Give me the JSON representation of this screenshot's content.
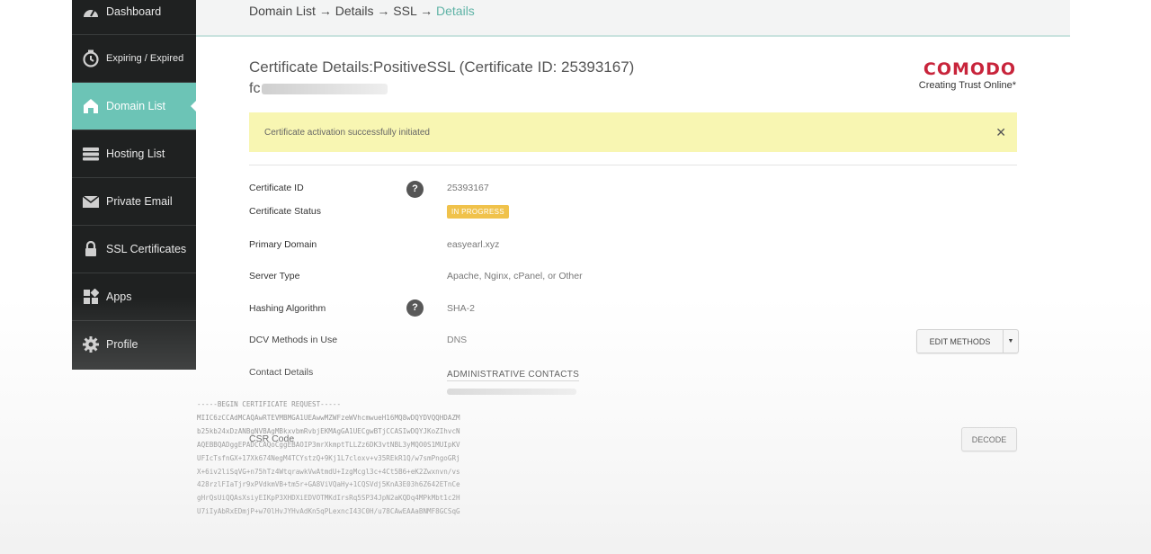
{
  "sidebar": {
    "items": [
      {
        "label": "Dashboard",
        "icon": "dashboard-icon"
      },
      {
        "label": "Expiring / Expired",
        "icon": "clock-icon"
      },
      {
        "label": "Domain List",
        "icon": "home-icon",
        "active": true
      },
      {
        "label": "Hosting List",
        "icon": "server-icon"
      },
      {
        "label": "Private Email",
        "icon": "envelope-icon"
      },
      {
        "label": "SSL Certificates",
        "icon": "lock-icon"
      },
      {
        "label": "Apps",
        "icon": "apps-icon"
      },
      {
        "label": "Profile",
        "icon": "gear-icon"
      }
    ]
  },
  "breadcrumb": {
    "items": [
      "Domain List",
      "Details",
      "SSL"
    ],
    "current": "Details",
    "separator": "→"
  },
  "page": {
    "title": "Certificate Details:PositiveSSL (Certificate ID: 25393167)",
    "subtitle_prefix": "fc"
  },
  "brand": {
    "name": "COMODO",
    "tagline": "Creating Trust Online*",
    "color": "#c8243b"
  },
  "alert": {
    "message": "Certificate activation successfully initiated",
    "close": "✕"
  },
  "details": {
    "certificate_id": {
      "label": "Certificate ID",
      "value": "25393167"
    },
    "status": {
      "label": "Certificate Status",
      "value": "IN PROGRESS"
    },
    "primary_domain": {
      "label": "Primary Domain",
      "value": "easyearl.xyz"
    },
    "server_type": {
      "label": "Server Type",
      "value": "Apache, Nginx, cPanel, or Other"
    },
    "hashing": {
      "label": "Hashing Algorithm",
      "value": "SHA-2"
    },
    "dcv": {
      "label": "DCV Methods in Use",
      "value": "DNS",
      "button": "EDIT METHODS"
    },
    "contact": {
      "label": "Contact Details",
      "heading": "ADMINISTRATIVE CONTACTS"
    },
    "csr": {
      "label": "CSR Code",
      "button": "DECODE"
    }
  },
  "help_glyph": "?",
  "csr_text": "-----BEGIN CERTIFICATE REQUEST-----\nMIIC6zCCAdMCAQAwRTEVMBMGA1UEAwwMZWFzeWVhcmwueH16MQ8wDQYDVQQHDAZM\nb25kb24xDzANBgNVBAgMBkxvbmRvbjEKMAgGA1UECgwBTjCCASIwDQYJKoZIhvcN\nAQEBBQADggEPADCCAQoCggEBAOIP3mrXkmptTLLZz6DK3vtNBL3yMQO0S1MUIpKV\nUFIcTsfnGX+17Xk674NegM4TCYstzQ+9Kj1L7cloxv+v35REkR1Q/w7smPngoGRj\nX+6iv2liSqVG+n75hTz4WtqrawkVwAtmdU+IzgMcgl3c+4Ct5B6+eK2Zwxnvn/vs\n428rzlFIaTjr9xPVdkmVB+tm5r+GA8ViVQaHy+1CQSVdj5KnA3E03h6Z642ETnCe\ngHrQsUiQQAsXsiyEIKpP3XHDXiEDVOTMKdIrsRq5SP34JpN2aKQDq4MPkMbt1c2H\nU7iIyAbRxEDmjP+w70lHvJYHvAdKn5qPLexncI43C0H/u78CAwEAAaBNMF8GCSqG"
}
